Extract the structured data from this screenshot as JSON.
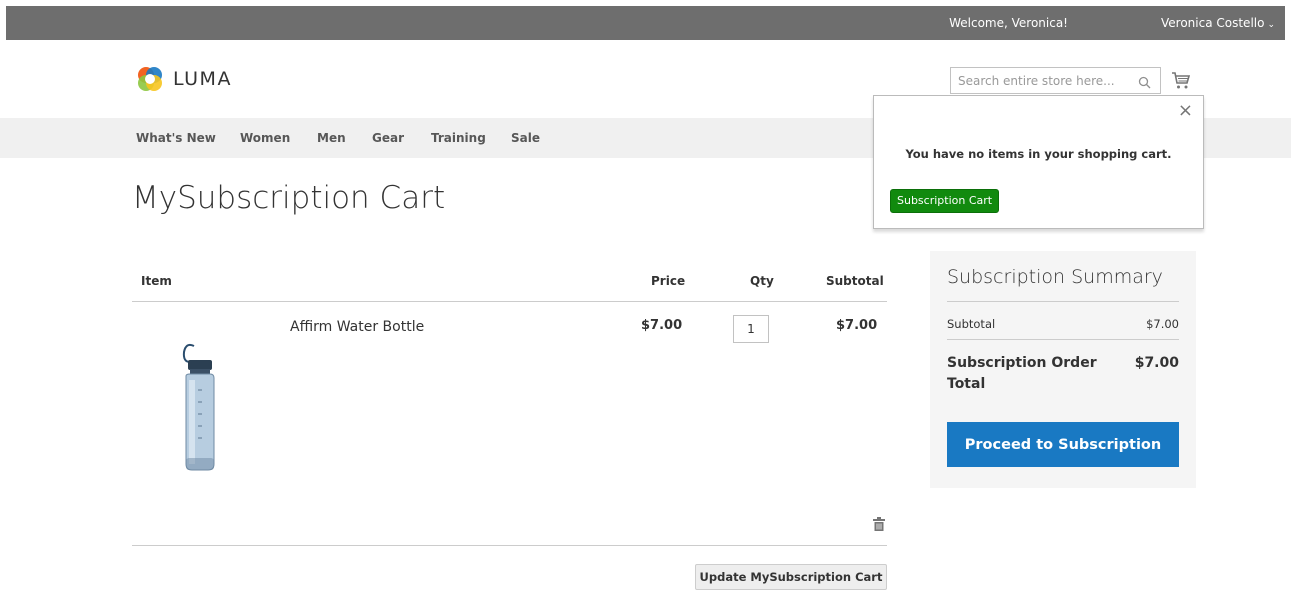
{
  "header": {
    "welcome": "Welcome, Veronica!",
    "customer_name": "Veronica Costello",
    "logo_text": "LUMA",
    "search_placeholder": "Search entire store here..."
  },
  "nav": {
    "items": [
      "What's New",
      "Women",
      "Men",
      "Gear",
      "Training",
      "Sale"
    ]
  },
  "page": {
    "title": "MySubscription Cart"
  },
  "minicart": {
    "message": "You have no items in your shopping cart.",
    "button_label": "Subscription Cart",
    "close_glyph": "×"
  },
  "cart": {
    "columns": {
      "item": "Item",
      "price": "Price",
      "qty": "Qty",
      "subtotal": "Subtotal"
    },
    "items": [
      {
        "name": "Affirm Water Bottle",
        "price": "$7.00",
        "qty": "1",
        "subtotal": "$7.00"
      }
    ],
    "update_label": "Update MySubscription Cart"
  },
  "summary": {
    "title": "Subscription Summary",
    "subtotal_label": "Subtotal",
    "subtotal_value": "$7.00",
    "total_label": "Subscription Order Total",
    "total_value": "$7.00",
    "proceed_label": "Proceed to Subscription"
  },
  "colors": {
    "top_bar": "#6e6e6e",
    "nav_bg": "#f0f0f0",
    "primary_button": "#1979c3",
    "minicart_button": "#118a0e",
    "summary_bg": "#f5f5f5"
  },
  "icons": {
    "search": "search-icon",
    "cart": "cart-icon",
    "close": "close-icon",
    "trash": "trash-icon",
    "chevron": "chevron-down-icon"
  }
}
